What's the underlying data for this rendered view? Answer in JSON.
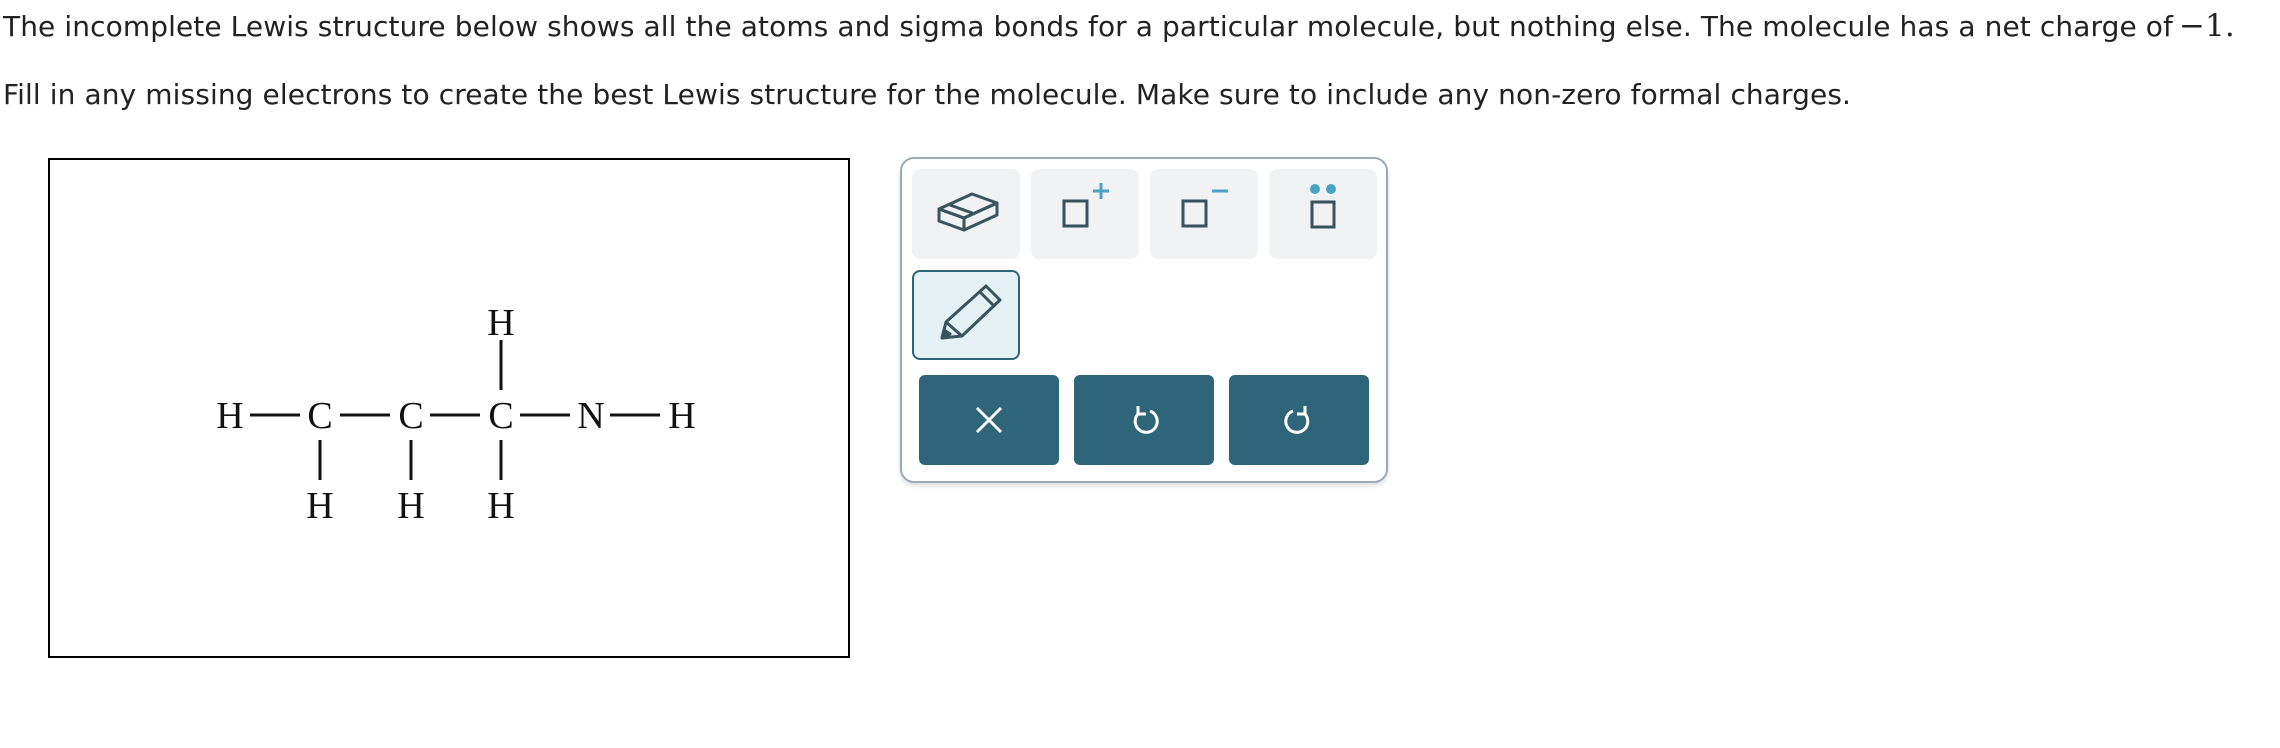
{
  "question": {
    "line1": "The incomplete Lewis structure below shows all the atoms and sigma bonds for a particular molecule, but nothing else. The molecule has a net charge of",
    "net_charge": "−1.",
    "line2": "Fill in any missing electrons to create the best Lewis structure for the molecule. Make sure to include any non-zero formal charges."
  },
  "molecule": {
    "atoms": {
      "h_left": "H",
      "c1": "C",
      "c2": "C",
      "c3": "C",
      "n": "N",
      "h_right": "H",
      "h_top": "H",
      "h_c1_bottom": "H",
      "h_c2_bottom": "H",
      "h_c3_bottom": "H"
    }
  },
  "toolbar": {
    "tools": [
      "eraser-tool",
      "positive-charge-tool",
      "negative-charge-tool",
      "lone-pair-tool",
      "pencil-tool"
    ],
    "selected_tool": "pencil-tool",
    "actions": [
      "clear-button",
      "undo-button",
      "redo-button"
    ],
    "colors": {
      "accent": "#2e6578",
      "charge_symbol": "#4aa3c4",
      "icon_stroke": "#37535e"
    }
  }
}
